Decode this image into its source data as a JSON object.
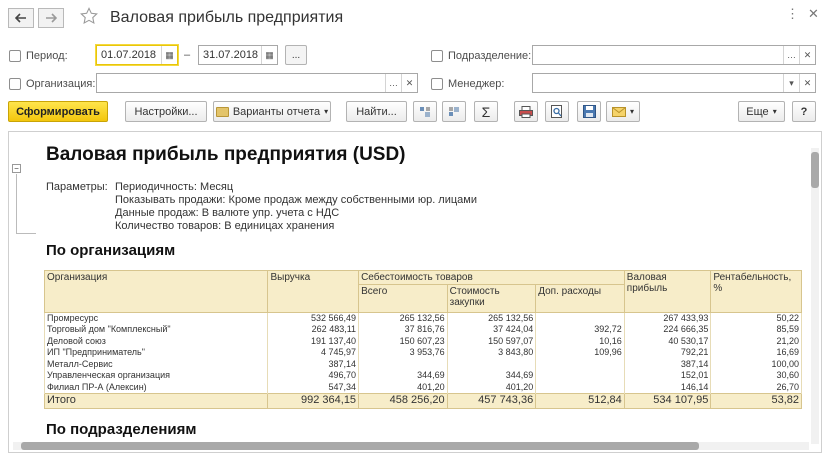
{
  "window": {
    "title": "Валовая прибыль предприятия",
    "back_icon": "arrow-left",
    "forward_icon": "arrow-right",
    "star_icon": "star",
    "menu_icon": "vertical-dots",
    "close_icon": "x"
  },
  "filters": {
    "period_label": "Период:",
    "period_from": "01.07.2018",
    "dash": "–",
    "period_to": "31.07.2018",
    "period_select": "...",
    "org_label": "Организация:",
    "org_value": "",
    "dept_label": "Подразделение:",
    "dept_value": "",
    "manager_label": "Менеджер:",
    "manager_value": ""
  },
  "toolbar": {
    "generate": "Сформировать",
    "settings": "Настройки...",
    "variants": "Варианты отчета",
    "find": "Найти...",
    "more": "Еще",
    "help": "?"
  },
  "report": {
    "title": "Валовая прибыль предприятия (USD)",
    "params_label": "Параметры:",
    "params": [
      "Периодичность: Месяц",
      "Показывать продажи: Кроме продаж между собственными юр. лицами",
      "Данные продаж: В валюте упр. учета с НДС",
      "Количество товаров: В единицах хранения"
    ],
    "section1": "По организациям",
    "section2": "По подразделениям",
    "headers": {
      "org": "Организация",
      "revenue": "Выручка",
      "cost": "Себестоимость товаров",
      "total": "Всего",
      "purchase": "Стоимость закупки",
      "extra": "Доп. расходы",
      "gross": "Валовая прибыль",
      "profitability": "Рентабельность, %"
    },
    "rows": [
      {
        "org": "Промресурс",
        "revenue": "532 566,49",
        "total": "265 132,56",
        "purchase": "265 132,56",
        "extra": "",
        "gross": "267 433,93",
        "rent": "50,22"
      },
      {
        "org": "Торговый дом \"Комплексный\"",
        "revenue": "262 483,11",
        "total": "37 816,76",
        "purchase": "37 424,04",
        "extra": "392,72",
        "gross": "224 666,35",
        "rent": "85,59"
      },
      {
        "org": "Деловой союз",
        "revenue": "191 137,40",
        "total": "150 607,23",
        "purchase": "150 597,07",
        "extra": "10,16",
        "gross": "40 530,17",
        "rent": "21,20"
      },
      {
        "org": "ИП \"Предприниматель\"",
        "revenue": "4 745,97",
        "total": "3 953,76",
        "purchase": "3 843,80",
        "extra": "109,96",
        "gross": "792,21",
        "rent": "16,69"
      },
      {
        "org": "Металл-Сервис",
        "revenue": "387,14",
        "total": "",
        "purchase": "",
        "extra": "",
        "gross": "387,14",
        "rent": "100,00"
      },
      {
        "org": "Управленческая организация",
        "revenue": "496,70",
        "total": "344,69",
        "purchase": "344,69",
        "extra": "",
        "gross": "152,01",
        "rent": "30,60"
      },
      {
        "org": "Филиал ПР-А (Алексин)",
        "revenue": "547,34",
        "total": "401,20",
        "purchase": "401,20",
        "extra": "",
        "gross": "146,14",
        "rent": "26,70"
      }
    ],
    "totals": {
      "org": "Итого",
      "revenue": "992 364,15",
      "total": "458 256,20",
      "purchase": "457 743,36",
      "extra": "512,84",
      "gross": "534 107,95",
      "rent": "53,82"
    }
  }
}
